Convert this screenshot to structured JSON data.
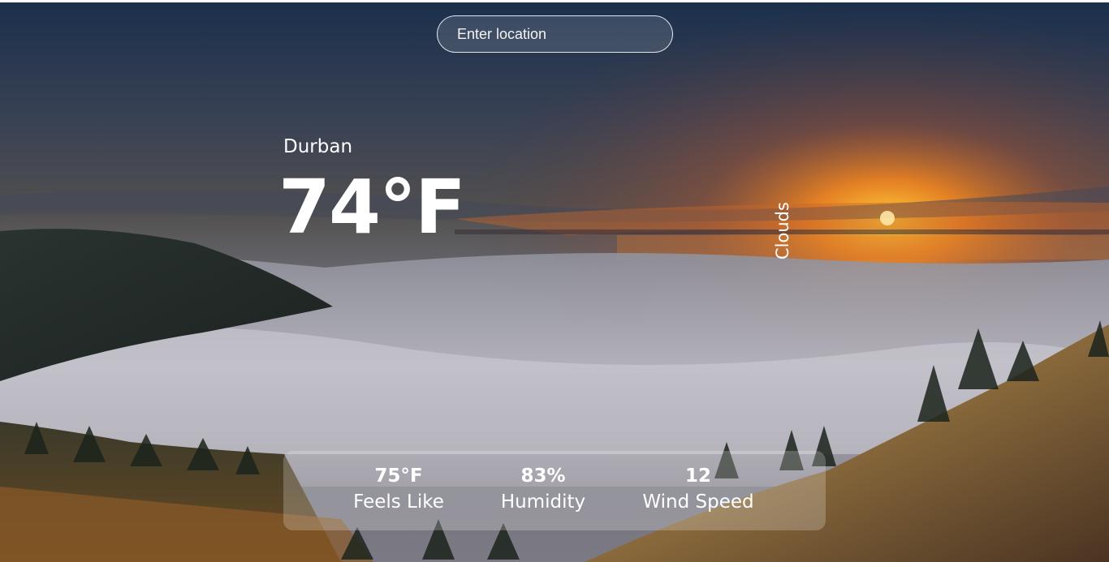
{
  "search": {
    "placeholder": "Enter location"
  },
  "weather": {
    "location": "Durban",
    "temperature": "74°F",
    "condition": "Clouds"
  },
  "stats": [
    {
      "value": "75°F",
      "label": "Feels Like"
    },
    {
      "value": "83%",
      "label": "Humidity"
    },
    {
      "value": "12",
      "label": "Wind Speed"
    }
  ],
  "colors": {
    "text": "#ffffff",
    "sky_top": "#1d3250",
    "sunset": "#ff8a1c",
    "fog": "#c9c8d0"
  }
}
